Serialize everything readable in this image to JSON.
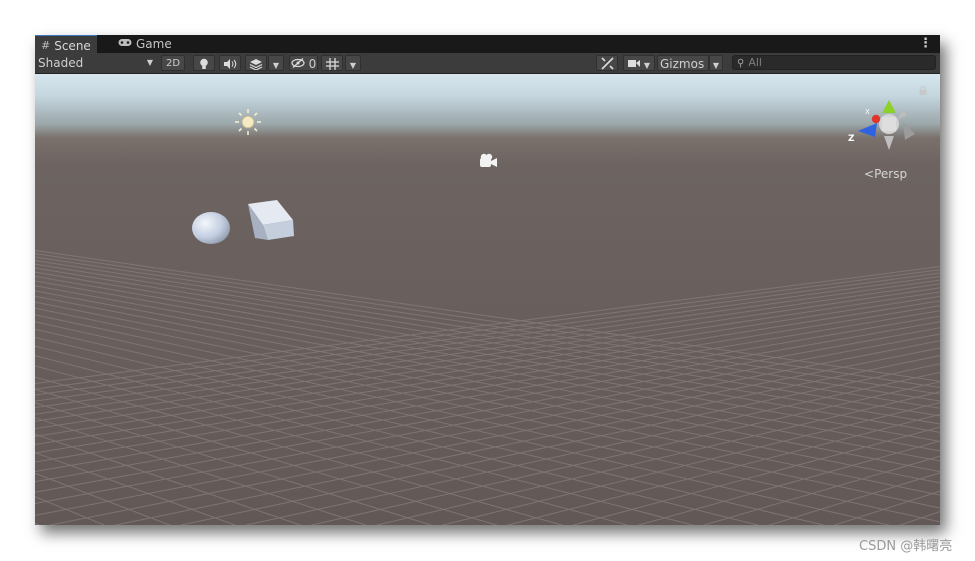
{
  "tabs": [
    {
      "label": "Scene",
      "icon": "grid-icon",
      "active": true
    },
    {
      "label": "Game",
      "icon": "gamepad-icon",
      "active": false
    }
  ],
  "toolbar": {
    "shading_mode": "Shaded",
    "mode_2d_label": "2D",
    "hidden_count": "0",
    "gizmos_label": "Gizmos",
    "search_placeholder": "All"
  },
  "viewport": {
    "projection_label": "Persp",
    "gizmo_axes": {
      "x": "X",
      "z": "Z"
    },
    "colors": {
      "x_axis": "#e0352a",
      "y_axis": "#8cd12a",
      "z_axis": "#2f63e0",
      "sky": "#d7e6ee",
      "ground": "#655b58"
    }
  },
  "watermark": "CSDN @韩曙亮"
}
